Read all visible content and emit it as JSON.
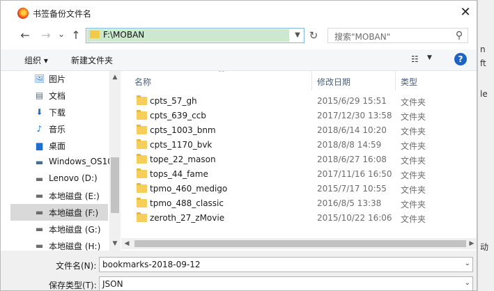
{
  "window": {
    "title": "书签备份文件名",
    "close_glyph": "✕"
  },
  "nav": {
    "back_glyph": "←",
    "forward_glyph": "→",
    "recent_glyph": "⌄",
    "up_glyph": "↑",
    "address": "F:\\MOBAN",
    "refresh_glyph": "↻",
    "search_placeholder": "搜索\"MOBAN\"",
    "search_glyph": "⚲"
  },
  "toolbar": {
    "organize": "组织 ▾",
    "new_folder": "新建文件夹",
    "view_glyph": "☷",
    "view_arrow": "▼",
    "help_glyph": "?"
  },
  "sidebar": {
    "items": [
      {
        "label": "图片",
        "icon": "🖼",
        "icon_color": "#3a7bd5"
      },
      {
        "label": "文档",
        "icon": "▤",
        "icon_color": "#5a6a7a"
      },
      {
        "label": "下载",
        "icon": "⬇",
        "icon_color": "#1f6fd1"
      },
      {
        "label": "音乐",
        "icon": "♪",
        "icon_color": "#1f6fd1"
      },
      {
        "label": "桌面",
        "icon": "▆",
        "icon_color": "#1f6fd1"
      },
      {
        "label": "Windows_OS10",
        "icon": "▬",
        "icon_color": "#4b6b8c"
      },
      {
        "label": "Lenovo (D:)",
        "icon": "▬",
        "icon_color": "#6c6c6c"
      },
      {
        "label": "本地磁盘 (E:)",
        "icon": "▬",
        "icon_color": "#6c6c6c"
      },
      {
        "label": "本地磁盘 (F:)",
        "icon": "▬",
        "icon_color": "#6c6c6c",
        "selected": true
      },
      {
        "label": "本地磁盘 (G:)",
        "icon": "▬",
        "icon_color": "#6c6c6c"
      },
      {
        "label": "本地磁盘 (H:)",
        "icon": "▬",
        "icon_color": "#6c6c6c"
      }
    ],
    "scroll_up": "▲",
    "scroll_down": "▼"
  },
  "list": {
    "sort_glyph": "^",
    "columns": {
      "name": "名称",
      "date": "修改日期",
      "type": "类型"
    },
    "rows": [
      {
        "name": "cpts_57_gh",
        "date": "2015/6/29 15:51",
        "type": "文件夹"
      },
      {
        "name": "cpts_639_ccb",
        "date": "2017/12/30 13:58",
        "type": "文件夹"
      },
      {
        "name": "cpts_1003_bnm",
        "date": "2018/6/14 10:20",
        "type": "文件夹"
      },
      {
        "name": "cpts_1170_bvk",
        "date": "2018/8/8 14:59",
        "type": "文件夹"
      },
      {
        "name": "tope_22_mason",
        "date": "2018/6/27 16:08",
        "type": "文件夹"
      },
      {
        "name": "tops_44_fame",
        "date": "2017/11/16 16:50",
        "type": "文件夹"
      },
      {
        "name": "tpmo_460_medigo",
        "date": "2015/7/17 10:55",
        "type": "文件夹"
      },
      {
        "name": "tpmo_488_classic",
        "date": "2016/8/5 13:38",
        "type": "文件夹"
      },
      {
        "name": "zeroth_27_zMovie",
        "date": "2015/10/22 16:06",
        "type": "文件夹"
      }
    ],
    "hscroll_left": "◀",
    "hscroll_right": "▶"
  },
  "bottom": {
    "filename_label": "文件名(N):",
    "filename_value": "bookmarks-2018-09-12",
    "filetype_label": "保存类型(T):",
    "filetype_value": "JSON",
    "dropdown_glyph": "⌄"
  },
  "background_fragments": [
    "n",
    "ft",
    "le",
    "动"
  ]
}
